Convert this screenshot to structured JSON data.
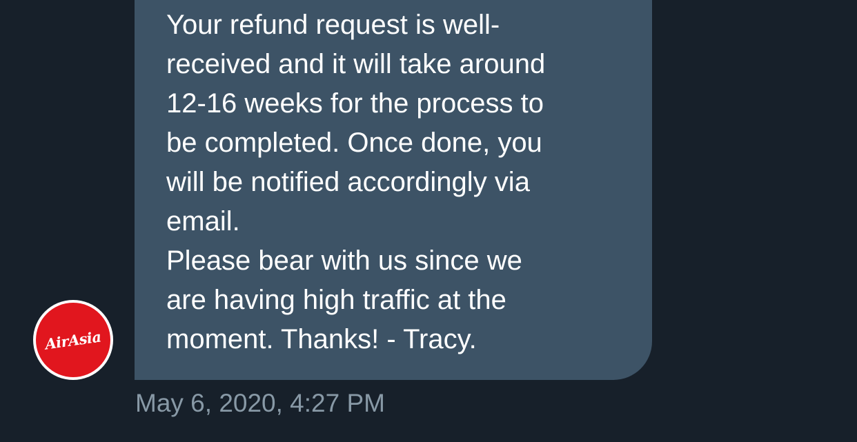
{
  "message": {
    "lines": [
      "Your refund request is well-",
      "received and it will take around",
      "12-16 weeks for the process to",
      "be completed. Once done, you",
      "will be notified accordingly via",
      "email.",
      "Please bear with us since we",
      "are having high traffic at the",
      "moment. Thanks! - Tracy."
    ],
    "timestamp": "May 6, 2020, 4:27 PM"
  },
  "sender": {
    "avatar_logo": "AirAsia",
    "avatar_color": "#e1161e"
  },
  "colors": {
    "background": "#17202a",
    "bubble": "#3d5366",
    "text": "#ffffff",
    "timestamp": "#8899a6"
  }
}
